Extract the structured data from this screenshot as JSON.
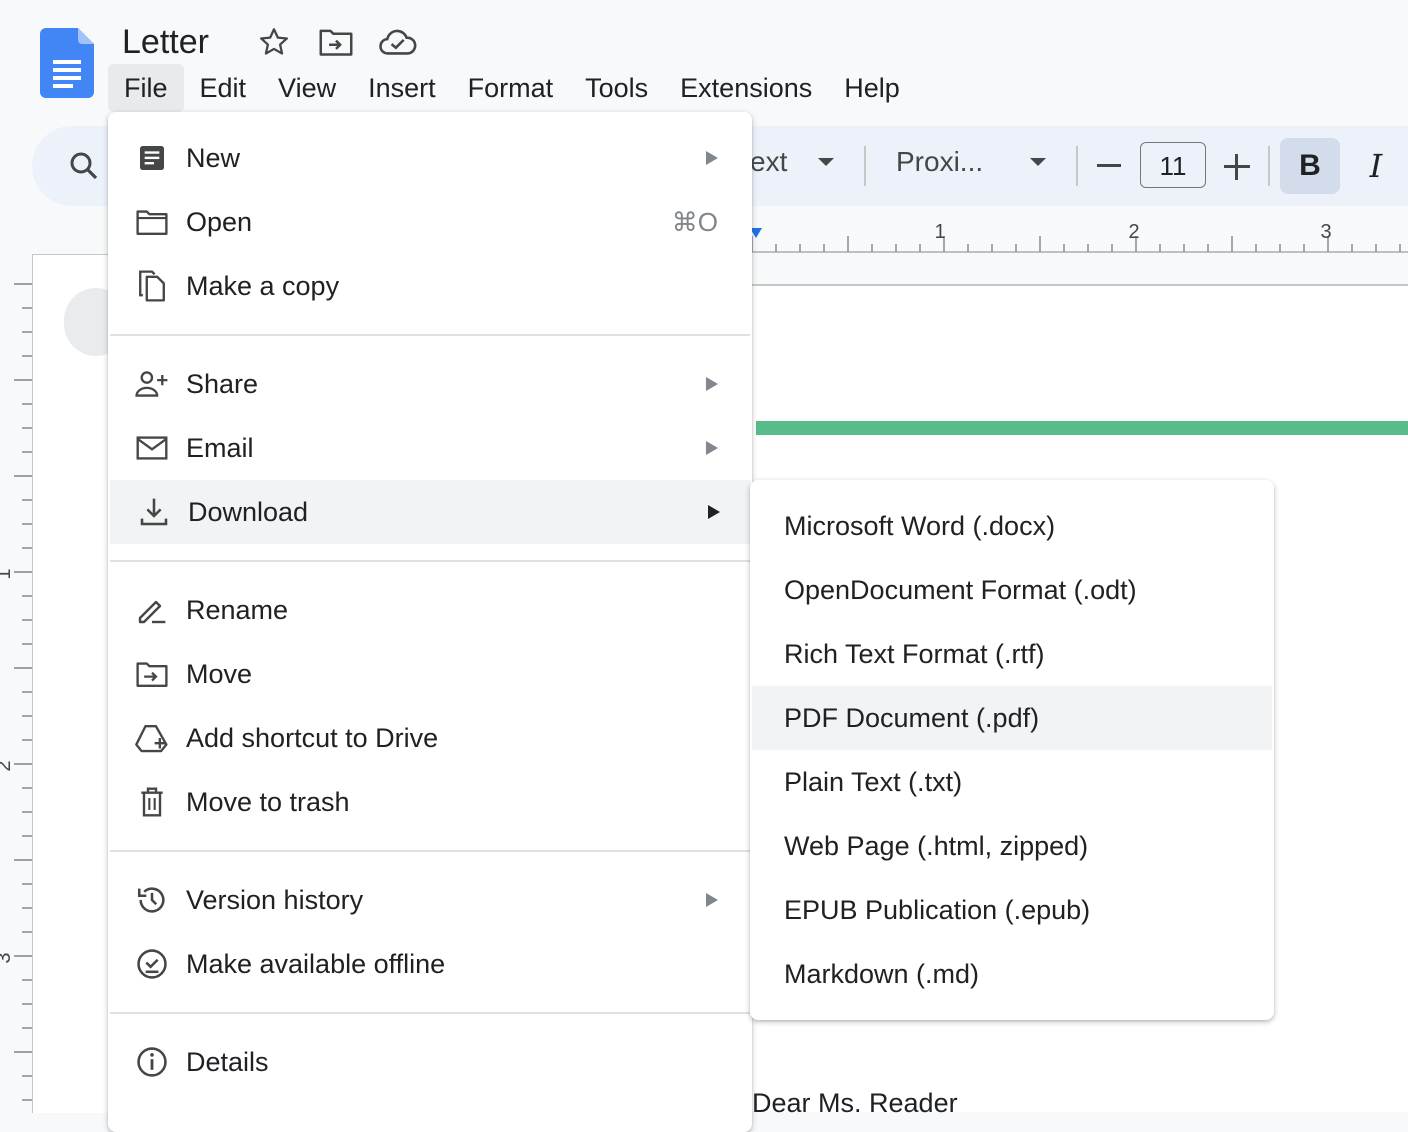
{
  "header": {
    "title": "Letter",
    "title_icons": [
      "star-icon",
      "move-folder-icon",
      "cloud-saved-icon"
    ]
  },
  "menubar": [
    "File",
    "Edit",
    "View",
    "Insert",
    "Format",
    "Tools",
    "Extensions",
    "Help"
  ],
  "menubar_active": "File",
  "toolbar": {
    "style_text": "ext",
    "font_text": "Proxi...",
    "font_size": "11",
    "bold": "B",
    "italic": "I"
  },
  "ruler": {
    "labels": [
      "1",
      "2",
      "3"
    ]
  },
  "vertical_ruler": {
    "labels": [
      "1",
      "2",
      "3"
    ]
  },
  "document": {
    "visible_text": "Dear Ms. Reader"
  },
  "file_menu": {
    "items": [
      {
        "label": "New",
        "icon": "new-doc-icon",
        "submenu": true
      },
      {
        "label": "Open",
        "icon": "folder-icon",
        "shortcut": "⌘O"
      },
      {
        "label": "Make a copy",
        "icon": "copy-icon"
      },
      {
        "label": "Share",
        "icon": "share-person-icon",
        "submenu": true
      },
      {
        "label": "Email",
        "icon": "email-icon",
        "submenu": true
      },
      {
        "label": "Download",
        "icon": "download-icon",
        "submenu": true,
        "highlighted": true
      },
      {
        "label": "Rename",
        "icon": "rename-icon"
      },
      {
        "label": "Move",
        "icon": "move-folder-icon"
      },
      {
        "label": "Add shortcut to Drive",
        "icon": "drive-shortcut-icon"
      },
      {
        "label": "Move to trash",
        "icon": "trash-icon"
      },
      {
        "label": "Version history",
        "icon": "history-icon",
        "submenu": true
      },
      {
        "label": "Make available offline",
        "icon": "offline-icon"
      },
      {
        "label": "Details",
        "icon": "info-icon"
      }
    ]
  },
  "download_submenu": {
    "items": [
      "Microsoft Word (.docx)",
      "OpenDocument Format (.odt)",
      "Rich Text Format (.rtf)",
      "PDF Document (.pdf)",
      "Plain Text (.txt)",
      "Web Page (.html, zipped)",
      "EPUB Publication (.epub)",
      "Markdown (.md)"
    ],
    "highlighted": "PDF Document (.pdf)"
  },
  "colors": {
    "docs_blue": "#4285f4",
    "toolbar_bg": "#edf2fa",
    "bold_active_bg": "#d3dcea",
    "hover_bg": "#f1f3f4",
    "green_accent": "#57bb8a"
  }
}
